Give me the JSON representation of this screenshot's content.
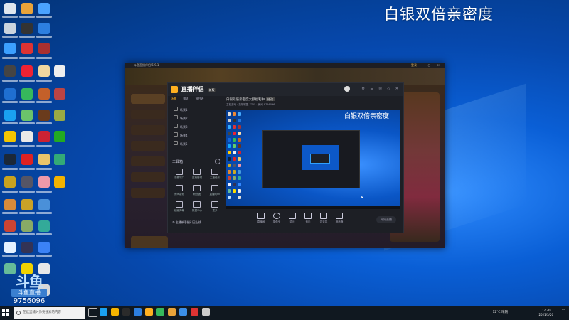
{
  "overlay_title": "白银双倍亲密度",
  "watermark": {
    "logo": "斗鱼",
    "sub": "斗鱼直播",
    "room_number": "9756096"
  },
  "app": {
    "title": "斗鱼直播伴侣 5.9.1",
    "top_right": "登录"
  },
  "studio": {
    "logo_text": "直播伴侣",
    "logo_badge": "新版",
    "sub_tabs": [
      "场景",
      "推流",
      "节目表"
    ],
    "scenes": [
      "场景1",
      "场景2",
      "场景3",
      "场景4",
      "场景5"
    ],
    "stream_title": "白银双倍亲密度大额福利中",
    "stream_title_tag": "修改",
    "stream_meta": "主机游戏 · 英雄联盟   7755 · 房间 9756096",
    "tools_title": "工具箱",
    "tools": [
      "观看端口",
      "直播管理",
      "主播任务",
      "房间装修",
      "粉丝团",
      "直播间PK",
      "超级弹幕",
      "数据中心",
      "更多"
    ],
    "preview_title": "白银双倍亲密度",
    "controls": [
      "直播间",
      "摄像头",
      "游戏",
      "音乐",
      "麦克风",
      "扬声器"
    ],
    "start_button": "开始直播",
    "guide_text": "① 主播新手指引已上线"
  },
  "taskbar": {
    "search_placeholder": "在这里输入你要搜索的内容",
    "weather": "12°C 晴朗",
    "clock_time": "17:30",
    "clock_date": "2021/3/20"
  },
  "colors": {
    "desktop_blue": "#0a5fd6",
    "app_bg": "#151821",
    "accent": "#ffb020"
  }
}
